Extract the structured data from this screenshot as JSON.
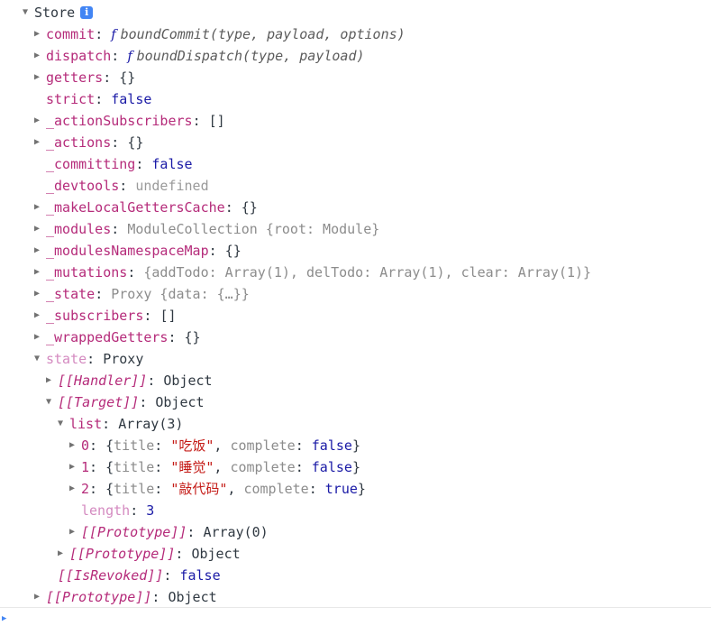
{
  "panel": {
    "root_label": "Store",
    "info_icon": "info-icon",
    "info_glyph": "i",
    "prompt_value": "",
    "colors": {
      "key": "#b52b7a",
      "key_dim": "#d48ac0",
      "string": "#c41a16",
      "boolean": "#1a1aa6",
      "number": "#1a1aa6",
      "undefined": "#9a9a9a",
      "object": "#303942",
      "accent": "#4285f4",
      "background": "#ffffff"
    }
  },
  "rows": [
    {
      "id": "store",
      "level": 0,
      "tri": "open",
      "key": "Store",
      "keyStyle": "title",
      "sep": "",
      "value": "",
      "valueStyle": "obj"
    },
    {
      "id": "commit",
      "level": 1,
      "tri": "closed",
      "key": "commit",
      "keyStyle": "name",
      "sep": ": ",
      "value": "boundCommit(type, payload, options)",
      "valueStyle": "fn"
    },
    {
      "id": "dispatch",
      "level": 1,
      "tri": "closed",
      "key": "dispatch",
      "keyStyle": "name",
      "sep": ": ",
      "value": "boundDispatch(type, payload)",
      "valueStyle": "fn"
    },
    {
      "id": "getters",
      "level": 1,
      "tri": "closed",
      "key": "getters",
      "keyStyle": "name",
      "sep": ": ",
      "value": "{}",
      "valueStyle": "obj"
    },
    {
      "id": "strict",
      "level": 1,
      "tri": "none",
      "key": "strict",
      "keyStyle": "name",
      "sep": ": ",
      "value": "false",
      "valueStyle": "bool"
    },
    {
      "id": "_actionSubscribers",
      "level": 1,
      "tri": "closed",
      "key": "_actionSubscribers",
      "keyStyle": "name",
      "sep": ": ",
      "value": "[]",
      "valueStyle": "obj"
    },
    {
      "id": "_actions",
      "level": 1,
      "tri": "closed",
      "key": "_actions",
      "keyStyle": "name",
      "sep": ": ",
      "value": "{}",
      "valueStyle": "obj"
    },
    {
      "id": "_committing",
      "level": 1,
      "tri": "none",
      "key": "_committing",
      "keyStyle": "name",
      "sep": ": ",
      "value": "false",
      "valueStyle": "bool"
    },
    {
      "id": "_devtools",
      "level": 1,
      "tri": "none",
      "key": "_devtools",
      "keyStyle": "name",
      "sep": ": ",
      "value": "undefined",
      "valueStyle": "undef"
    },
    {
      "id": "_makeLocalGettersCache",
      "level": 1,
      "tri": "closed",
      "key": "_makeLocalGettersCache",
      "keyStyle": "name",
      "sep": ": ",
      "value": "{}",
      "valueStyle": "obj"
    },
    {
      "id": "_modules",
      "level": 1,
      "tri": "closed",
      "key": "_modules",
      "keyStyle": "name",
      "sep": ": ",
      "value": "ModuleCollection {root: Module}",
      "valueStyle": "dim"
    },
    {
      "id": "_modulesNamespaceMap",
      "level": 1,
      "tri": "closed",
      "key": "_modulesNamespaceMap",
      "keyStyle": "name",
      "sep": ": ",
      "value": "{}",
      "valueStyle": "obj"
    },
    {
      "id": "_mutations",
      "level": 1,
      "tri": "closed",
      "key": "_mutations",
      "keyStyle": "name",
      "sep": ": ",
      "value": "{addTodo: Array(1), delTodo: Array(1), clear: Array(1)}",
      "valueStyle": "dim"
    },
    {
      "id": "_state",
      "level": 1,
      "tri": "closed",
      "key": "_state",
      "keyStyle": "name",
      "sep": ": ",
      "value": "Proxy {data: {…}}",
      "valueStyle": "dim"
    },
    {
      "id": "_subscribers",
      "level": 1,
      "tri": "closed",
      "key": "_subscribers",
      "keyStyle": "name",
      "sep": ": ",
      "value": "[]",
      "valueStyle": "obj"
    },
    {
      "id": "_wrappedGetters",
      "level": 1,
      "tri": "closed",
      "key": "_wrappedGetters",
      "keyStyle": "name",
      "sep": ": ",
      "value": "{}",
      "valueStyle": "obj"
    },
    {
      "id": "state",
      "level": 1,
      "tri": "open",
      "key": "state",
      "keyStyle": "dim",
      "sep": ": ",
      "value": "Proxy",
      "valueStyle": "obj"
    },
    {
      "id": "state-handler",
      "level": 2,
      "tri": "closed",
      "key": "[[Handler]]",
      "keyStyle": "internal",
      "sep": ": ",
      "value": "Object",
      "valueStyle": "obj"
    },
    {
      "id": "state-target",
      "level": 2,
      "tri": "open",
      "key": "[[Target]]",
      "keyStyle": "internal",
      "sep": ": ",
      "value": "Object",
      "valueStyle": "obj"
    },
    {
      "id": "list",
      "level": 3,
      "tri": "open",
      "key": "list",
      "keyStyle": "name",
      "sep": ": ",
      "value": "Array(3)",
      "valueStyle": "obj"
    },
    {
      "id": "list-0",
      "level": 4,
      "tri": "closed",
      "key": "0",
      "keyStyle": "name",
      "sep": ": ",
      "value": "",
      "valueStyle": "todo",
      "todo": {
        "title": "吃饭",
        "complete": "false"
      }
    },
    {
      "id": "list-1",
      "level": 4,
      "tri": "closed",
      "key": "1",
      "keyStyle": "name",
      "sep": ": ",
      "value": "",
      "valueStyle": "todo",
      "todo": {
        "title": "睡觉",
        "complete": "false"
      }
    },
    {
      "id": "list-2",
      "level": 4,
      "tri": "closed",
      "key": "2",
      "keyStyle": "name",
      "sep": ": ",
      "value": "",
      "valueStyle": "todo",
      "todo": {
        "title": "敲代码",
        "complete": "true"
      }
    },
    {
      "id": "list-length",
      "level": 4,
      "tri": "none",
      "key": "length",
      "keyStyle": "dim",
      "sep": ": ",
      "value": "3",
      "valueStyle": "num"
    },
    {
      "id": "list-proto",
      "level": 4,
      "tri": "closed",
      "key": "[[Prototype]]",
      "keyStyle": "internal",
      "sep": ": ",
      "value": "Array(0)",
      "valueStyle": "obj"
    },
    {
      "id": "target-proto",
      "level": 3,
      "tri": "closed",
      "key": "[[Prototype]]",
      "keyStyle": "internal",
      "sep": ": ",
      "value": "Object",
      "valueStyle": "obj"
    },
    {
      "id": "state-isrevoked",
      "level": 2,
      "tri": "none",
      "key": "[[IsRevoked]]",
      "keyStyle": "internal",
      "sep": ": ",
      "value": "false",
      "valueStyle": "bool"
    },
    {
      "id": "store-proto",
      "level": 1,
      "tri": "closed",
      "key": "[[Prototype]]",
      "keyStyle": "internal",
      "sep": ": ",
      "value": "Object",
      "valueStyle": "obj"
    }
  ],
  "todo_tokens": {
    "open_brace": "{",
    "title_key": "title",
    "colon": ": ",
    "comma": ", ",
    "complete_key": "complete",
    "close_brace": "}",
    "quote": "\""
  }
}
